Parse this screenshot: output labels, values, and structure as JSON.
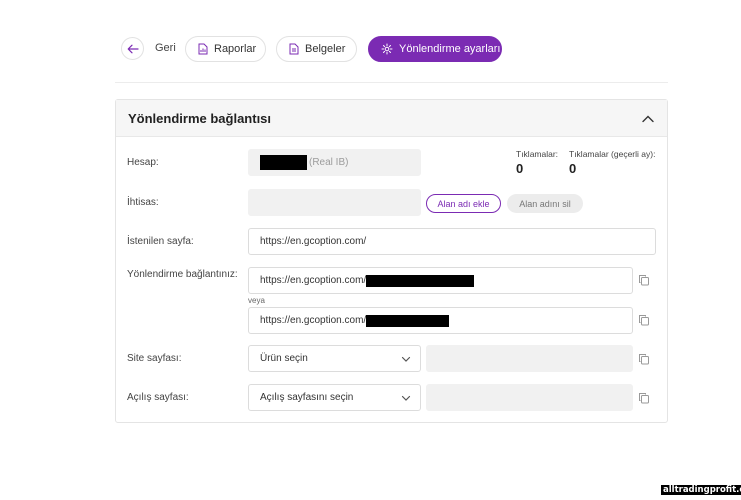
{
  "nav": {
    "back_label": "Geri",
    "reports_label": "Raporlar",
    "documents_label": "Belgeler",
    "redirect_settings_label": "Yönlendirme ayarları"
  },
  "card": {
    "title": "Yönlendirme bağlantısı",
    "account": {
      "label": "Hesap:",
      "suffix": "(Real IB)"
    },
    "stats": {
      "clicks_label": "Tıklamalar:",
      "clicks_value": "0",
      "clicks_month_label": "Tıklamalar (geçerli ay):",
      "clicks_month_value": "0"
    },
    "specialty": {
      "label": "İhtisas:",
      "value": "",
      "add_domain_label": "Alan adı ekle",
      "remove_domain_label": "Alan adını sil"
    },
    "desired_page": {
      "label": "İstenilen sayfa:",
      "value": "https://en.gcoption.com/"
    },
    "redirect_links": {
      "label": "Yönlendirme bağlantınız:",
      "link1_prefix": "https://en.gcoption.com/",
      "or_label": "veya",
      "link2_prefix": "https://en.gcoption.com/"
    },
    "site_page": {
      "label": "Site sayfası:",
      "select_value": "Ürün seçin",
      "field_value": ""
    },
    "landing_page": {
      "label": "Açılış sayfası:",
      "select_value": "Açılış sayfasını seçin",
      "field_value": ""
    }
  },
  "watermark": "alltradingprofit.com",
  "colors": {
    "accent": "#7b2bb3",
    "field_disabled": "#f1f1f1",
    "border": "#dcdcdc"
  },
  "icons": {
    "back": "arrow-left-icon",
    "reports": "document-chart-icon",
    "documents": "document-icon",
    "settings": "gear-icon",
    "collapse": "chevron-up-icon",
    "copy": "copy-icon",
    "select": "chevron-down-icon"
  }
}
